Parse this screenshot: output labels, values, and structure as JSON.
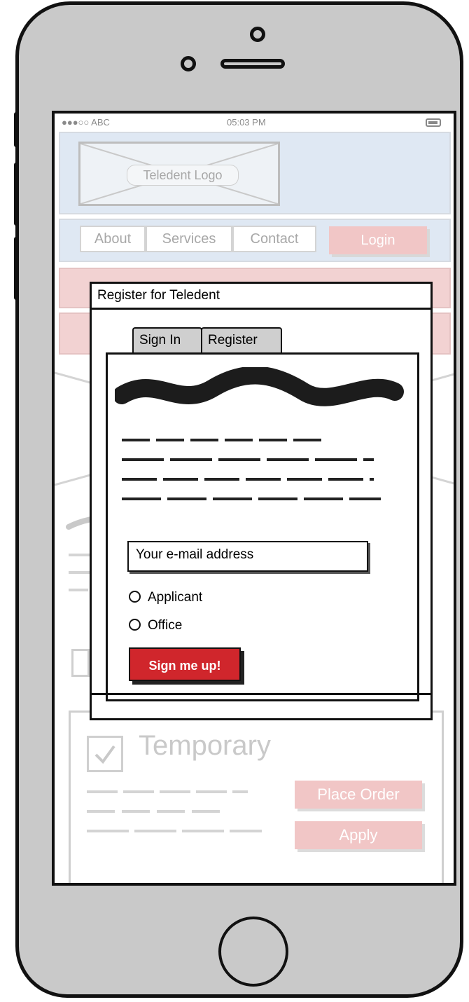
{
  "status_bar": {
    "carrier": "●●●○○ ABC",
    "time": "05:03 PM"
  },
  "header": {
    "logo_label": "Teledent Logo"
  },
  "nav": {
    "items": [
      {
        "label": "About"
      },
      {
        "label": "Services"
      },
      {
        "label": "Contact"
      }
    ],
    "login_label": "Login"
  },
  "background_card": {
    "heading": "Temporary",
    "place_order_label": "Place Order",
    "apply_label": "Apply"
  },
  "modal": {
    "title": "Register for Teledent",
    "tabs": [
      {
        "label": "Sign In"
      },
      {
        "label": "Register"
      }
    ],
    "active_tab": "Register",
    "email_placeholder": "Your e-mail address",
    "radio_options": [
      {
        "label": "Applicant"
      },
      {
        "label": "Office"
      }
    ],
    "submit_label": "Sign me up!"
  },
  "icons": {
    "radio": "radio-icon",
    "checkbox": "checkbox-icon",
    "battery": "battery-icon"
  },
  "colors": {
    "accent_red": "#d0262c",
    "faded_red": "#f1c6c6",
    "header_blue": "#dfe8f3",
    "phone_gray": "#c9c9c9"
  }
}
